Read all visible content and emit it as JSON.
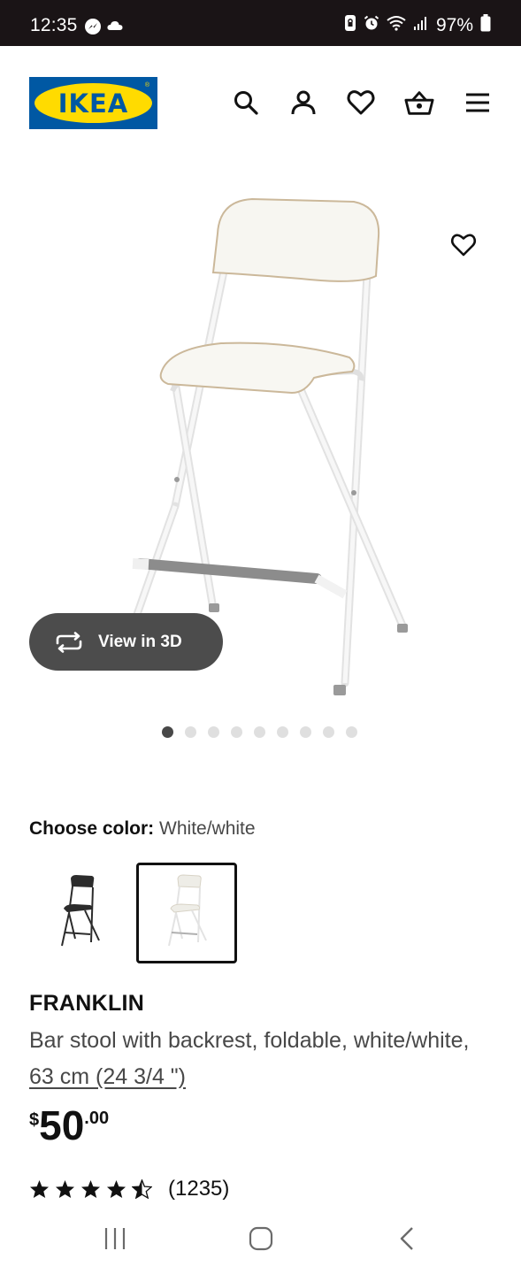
{
  "status_bar": {
    "time": "12:35",
    "battery": "97%",
    "icons": [
      "messenger-icon",
      "cloud-icon",
      "lock-screen-icon",
      "alarm-icon",
      "wifi-icon",
      "signal-icon",
      "battery-icon"
    ]
  },
  "header": {
    "logo_text": "IKEA",
    "logo_registered": "®",
    "icons": [
      "search-icon",
      "account-icon",
      "favorites-icon",
      "shopping-basket-icon",
      "menu-icon"
    ],
    "colors": {
      "logo_blue": "#0058a3",
      "logo_yellow": "#ffdb00"
    }
  },
  "product_image": {
    "favorite_icon": "heart-outline-icon",
    "view_3d_label": "View in 3D",
    "view_3d_icon": "rotate-arrows-icon",
    "carousel": {
      "total": 9,
      "active_index": 0
    }
  },
  "color_choice": {
    "label": "Choose color:",
    "selected": "White/white",
    "options": [
      "Black/black",
      "White/white"
    ]
  },
  "product": {
    "name": "FRANKLIN",
    "description_prefix": "Bar stool with backrest, foldable, white/white, ",
    "measurement": "63 cm (24 3/4 \")",
    "price": {
      "currency": "$",
      "integer": "50",
      "decimal": ".00"
    },
    "rating": {
      "stars": 4.5,
      "max": 5,
      "count": "(1235)"
    }
  },
  "android_nav": {
    "icons": [
      "recent-apps-icon",
      "home-icon",
      "back-icon"
    ]
  }
}
